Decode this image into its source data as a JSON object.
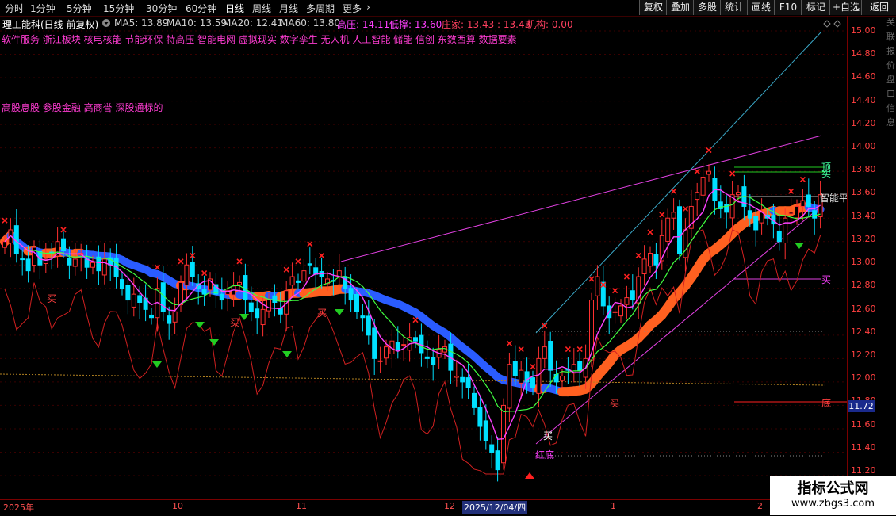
{
  "toolbar": {
    "periods": [
      "分时",
      "1分钟",
      "5分钟",
      "15分钟",
      "30分钟",
      "60分钟",
      "日线",
      "周线",
      "月线",
      "多周期",
      "更多"
    ],
    "active_period": "日线",
    "more_arrow": "›",
    "right_buttons": [
      "复权",
      "叠加",
      "多股",
      "统计",
      "画线",
      "F10",
      "标记",
      "+自选",
      "返回"
    ]
  },
  "info": {
    "stock_name": "理工能科(日线 前复权)",
    "ma5": "MA5: 13.89",
    "ma10": "MA10: 13.59",
    "ma20": "MA20: 12.41",
    "ma60": "MA60: 13.80",
    "high_pressure": "高压: 14.11",
    "low_support": "低撑: 13.60",
    "dealer": "庄家: 13.43 : 13.43",
    "institution": "机构: 0.00",
    "icons": [
      "gear-icon",
      "diamond-icon"
    ]
  },
  "concepts": {
    "line1": "软件服务 浙江板块 核电核能 节能环保 特高压 智能电网 虚拟现实 数字孪生 无人机 人工智能 储能 信创 东数西算 数据要素",
    "line2": "高股息股 参股金融 高商誉 深股通标的"
  },
  "axis": {
    "labels": [
      "15.00",
      "14.80",
      "14.60",
      "14.40",
      "14.20",
      "14.00",
      "13.80",
      "13.60",
      "13.40",
      "13.20",
      "13.00",
      "12.80",
      "12.60",
      "12.40",
      "12.20",
      "12.00",
      "11.80",
      "11.60",
      "11.40",
      "11.20"
    ],
    "current_price": "11.72"
  },
  "dates": {
    "labels": [
      "2025年",
      "10",
      "11",
      "12",
      "1",
      "2"
    ],
    "cursor_date": "2025/12/04/四"
  },
  "chart_labels": {
    "buy": "买",
    "red_bottom": "红底",
    "bottom": "底",
    "top": "顶",
    "sell": "卖",
    "smart_flat": "智能平"
  },
  "colors": {
    "up": "#ff3030",
    "down": "#00e0ff",
    "ma5": "#ff40ff",
    "ma10": "#40ff40",
    "ribbon_down": "#2a5cff",
    "ribbon_up": "#ff6020",
    "trend": "#e040e0",
    "channel": "#3aa8c8",
    "signal": "#22cc22"
  },
  "right_strip": [
    "关",
    "联",
    "报",
    "价",
    "盘",
    "口",
    "信",
    "息"
  ],
  "watermark": {
    "line1": "指标公式网",
    "line2": "www.zbgs3.com"
  },
  "chart_data": {
    "type": "candlestick",
    "symbol": "理工能科",
    "ylim": [
      11.2,
      15.0
    ],
    "y_ticks": [
      15.0,
      14.8,
      14.6,
      14.4,
      14.2,
      14.0,
      13.8,
      13.6,
      13.4,
      13.2,
      13.0,
      12.8,
      12.6,
      12.4,
      12.2,
      12.0,
      11.8,
      11.6,
      11.4,
      11.2
    ],
    "indicators": {
      "MA5": 13.89,
      "MA10": 13.59,
      "MA20": 12.41,
      "MA60": 13.8,
      "高压": 14.11,
      "低撑": 13.6,
      "庄家": [
        13.43,
        13.43
      ],
      "机构": 0.0
    },
    "closes": [
      13.2,
      13.3,
      13.1,
      13.05,
      12.95,
      13.15,
      13.0,
      13.05,
      13.1,
      13.2,
      13.12,
      13.0,
      13.05,
      13.1,
      12.98,
      13.02,
      12.95,
      13.05,
      13.0,
      12.9,
      12.8,
      12.7,
      12.75,
      12.68,
      12.62,
      12.55,
      12.8,
      12.6,
      12.5,
      12.6,
      12.85,
      13.0,
      12.9,
      12.8,
      12.75,
      12.88,
      12.75,
      12.7,
      12.78,
      12.82,
      12.85,
      12.7,
      12.6,
      12.55,
      12.62,
      12.7,
      12.68,
      12.58,
      12.78,
      12.9,
      12.85,
      12.95,
      13.0,
      12.92,
      12.9,
      12.88,
      12.86,
      12.95,
      12.8,
      12.7,
      12.6,
      12.55,
      12.4,
      12.2,
      12.18,
      12.3,
      12.35,
      12.28,
      12.32,
      12.38,
      12.35,
      12.25,
      12.2,
      12.15,
      12.28,
      12.3,
      12.1,
      12.05,
      12.0,
      11.95,
      11.78,
      11.62,
      11.5,
      11.4,
      11.25,
      11.8,
      12.15,
      12.05,
      12.1,
      12.0,
      11.95,
      12.2,
      12.3,
      12.1,
      12.0,
      12.05,
      12.1,
      12.15,
      12.1,
      12.2,
      12.7,
      12.9,
      12.65,
      12.55,
      12.6,
      12.65,
      12.72,
      12.7,
      12.9,
      13.05,
      13.1,
      13.0,
      13.25,
      13.4,
      13.45,
      13.1,
      13.3,
      13.5,
      13.62,
      13.75,
      13.8,
      13.55,
      13.48,
      13.45,
      13.6,
      13.62,
      13.5,
      13.4,
      13.3,
      13.45,
      13.4,
      13.35,
      13.2,
      13.4,
      13.45,
      13.5,
      13.55,
      13.5,
      13.4,
      13.6
    ],
    "date_axis": [
      "2025年",
      "10",
      "11",
      "12",
      "1",
      "2"
    ],
    "signals": {
      "buy": [
        "买",
        "买",
        "买"
      ],
      "bottom": [
        "红底",
        "底"
      ],
      "top": [
        "顶"
      ],
      "sell": [
        "卖"
      ],
      "flat": [
        "智能平"
      ]
    }
  }
}
